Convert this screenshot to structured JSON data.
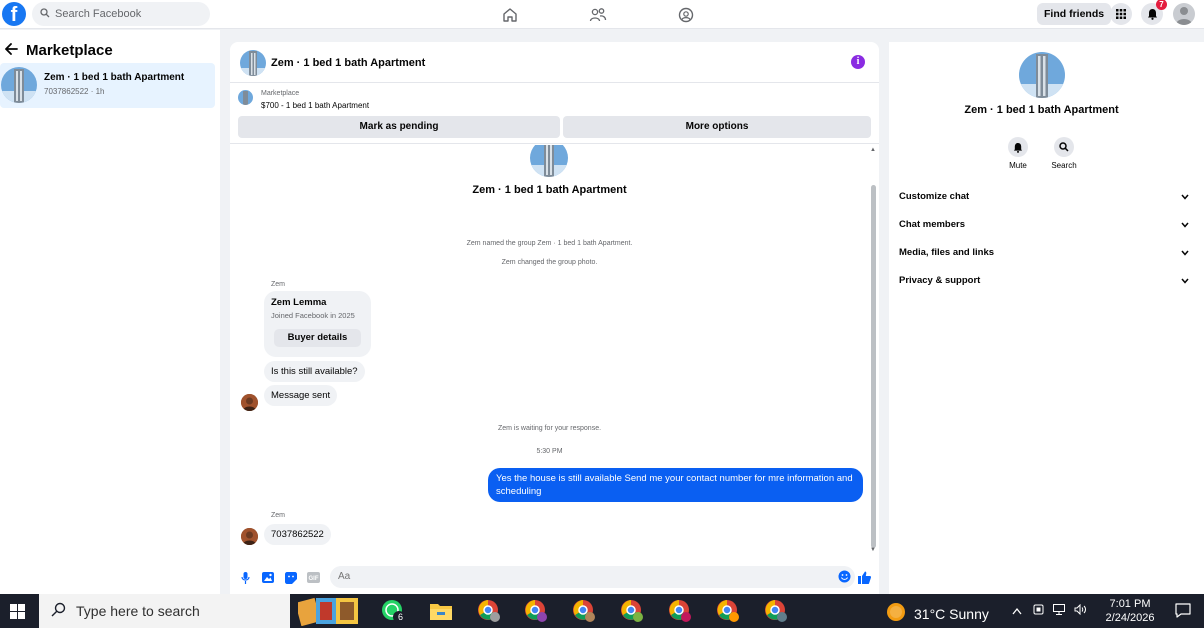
{
  "topbar": {
    "logo": "f",
    "search_placeholder": "Search Facebook",
    "find_friends": "Find friends",
    "notification_count": "7"
  },
  "left": {
    "back_title": "Marketplace",
    "conversation": {
      "title": "Zem · 1 bed 1 bath Apartment",
      "subtitle": "7037862522 · 1h"
    }
  },
  "chat": {
    "title": "Zem · 1 bed 1 bath Apartment",
    "info_glyph": "i",
    "listing_source": "Marketplace",
    "listing_price_title": "$700 - 1 bed 1 bath Apartment",
    "mark_pending": "Mark as pending",
    "more_options": "More options",
    "group_title": "Zem · 1 bed 1 bath Apartment",
    "sys_named": "Zem named the group Zem · 1 bed 1 bath Apartment.",
    "sys_photo": "Zem changed the group photo.",
    "sender1": "Zem",
    "card_name": "Zem Lemma",
    "card_joined": "Joined Facebook in 2025",
    "buyer_details": "Buyer details",
    "msg_available": "Is this still available?",
    "msg_sent": "Message sent",
    "sys_waiting": "Zem is waiting for your response.",
    "time": "5:30 PM",
    "my_reply": "Yes the house is still available  Send me your contact number for mre information and  scheduling",
    "sender2": "Zem",
    "msg_number": "7037862522",
    "composer_placeholder": "Aa"
  },
  "right": {
    "title": "Zem · 1 bed 1 bath Apartment",
    "mute": "Mute",
    "search": "Search",
    "rows": [
      "Customize chat",
      "Chat members",
      "Media, files and links",
      "Privacy & support"
    ]
  },
  "taskbar": {
    "search_placeholder": "Type here to search",
    "whatsapp_badge": "6",
    "weather": "31°C  Sunny",
    "time": "7:01 PM",
    "date": "2/24/2026"
  }
}
